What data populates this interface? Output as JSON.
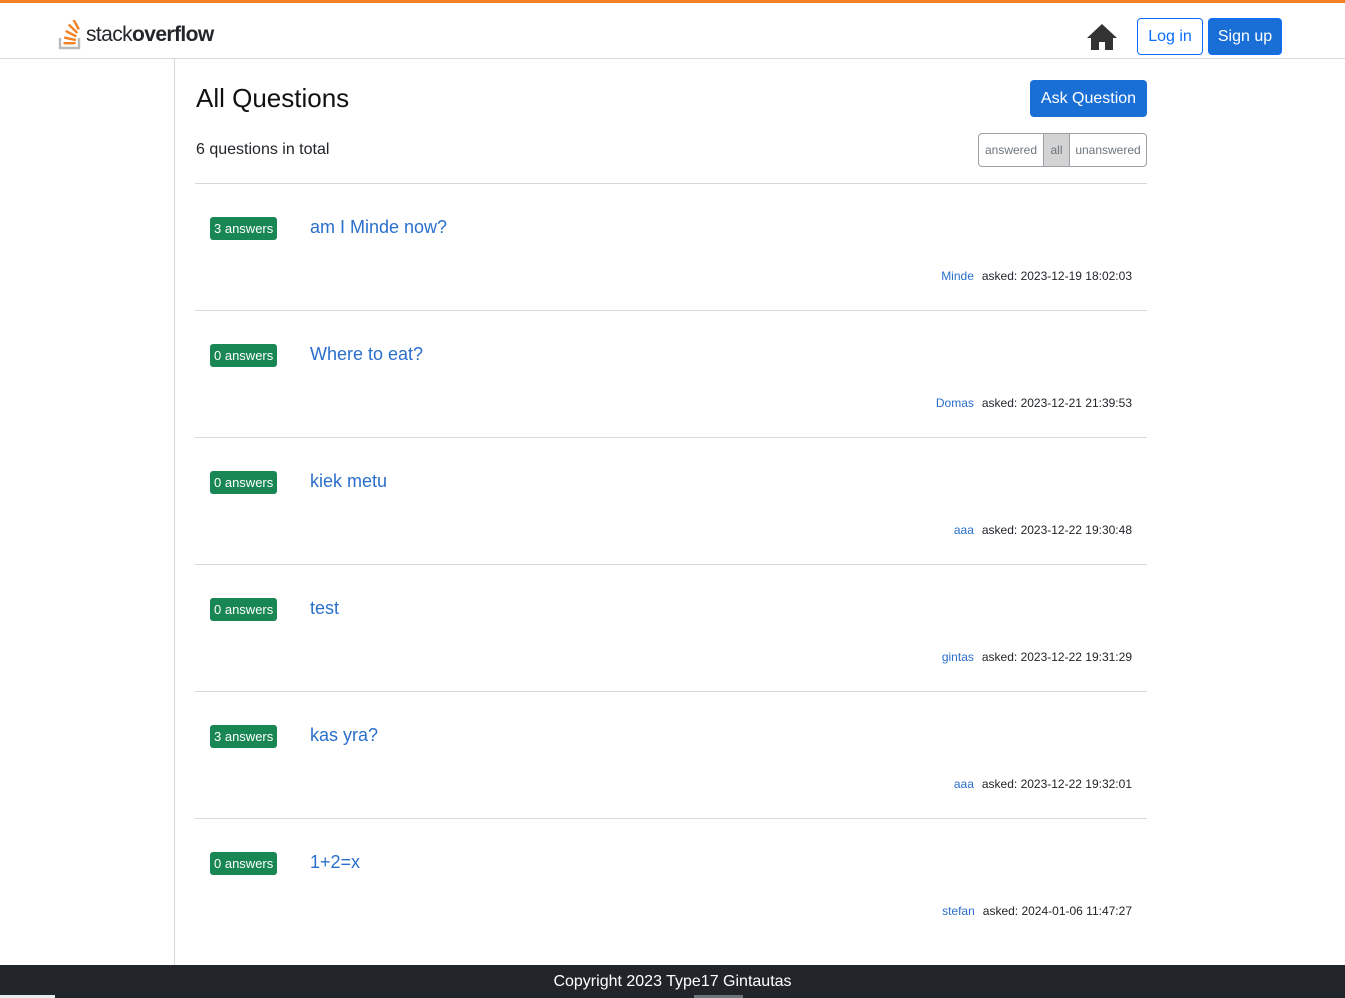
{
  "header": {
    "logo_text_a": "stack",
    "logo_text_b": "overflow",
    "home_icon": "home-icon",
    "login_label": "Log in",
    "signup_label": "Sign up",
    "accent_color": "#f48024",
    "primary_color": "#1a6fd6"
  },
  "main": {
    "title": "All Questions",
    "ask_label": "Ask Question",
    "total_text": "6 questions in total",
    "filters": [
      {
        "label": "answered",
        "active": false
      },
      {
        "label": "all",
        "active": true
      },
      {
        "label": "unanswered",
        "active": false
      }
    ]
  },
  "questions": [
    {
      "answers": "3 answers",
      "title": "am I Minde now?",
      "author": "Minde",
      "asked": "asked: 2023-12-19 18:02:03"
    },
    {
      "answers": "0 answers",
      "title": "Where to eat?",
      "author": "Domas",
      "asked": "asked: 2023-12-21 21:39:53"
    },
    {
      "answers": "0 answers",
      "title": "kiek metu",
      "author": "aaa",
      "asked": "asked: 2023-12-22 19:30:48"
    },
    {
      "answers": "0 answers",
      "title": "test",
      "author": "gintas",
      "asked": "asked: 2023-12-22 19:31:29"
    },
    {
      "answers": "3 answers",
      "title": "kas yra?",
      "author": "aaa",
      "asked": "asked: 2023-12-22 19:32:01"
    },
    {
      "answers": "0 answers",
      "title": "1+2=x",
      "author": "stefan",
      "asked": "asked: 2024-01-06 11:47:27"
    }
  ],
  "footer": {
    "text": "Copyright 2023 Type17 Gintautas"
  }
}
